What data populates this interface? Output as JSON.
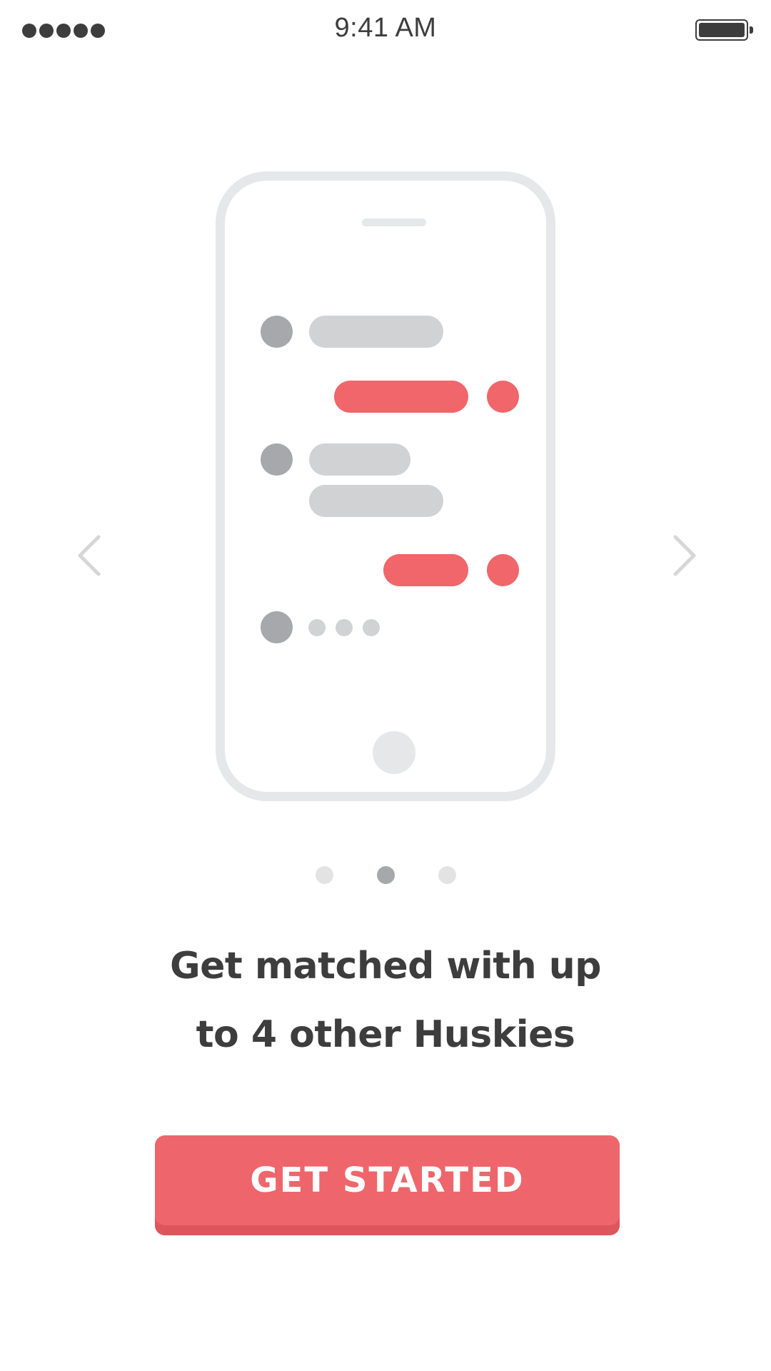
{
  "status_bar": {
    "time": "9:41 AM",
    "signal_icon": "signal-dots-icon",
    "battery_icon": "battery-full-icon"
  },
  "illustration": {
    "icon": "phone-chat-illustration",
    "colors": {
      "frame": "#e6e7e8",
      "incoming": "#d1d2d3",
      "incoming_avatar": "#a7a8ab",
      "outgoing": "#f0666b"
    }
  },
  "carousel": {
    "prev_icon": "chevron-left-icon",
    "next_icon": "chevron-right-icon",
    "current_page": 2,
    "total_pages": 3
  },
  "onboarding": {
    "headline_line1": "Get matched with up",
    "headline_line2": "to 4 other Huskies"
  },
  "cta": {
    "label": "GET STARTED",
    "color": "#ee666b"
  }
}
